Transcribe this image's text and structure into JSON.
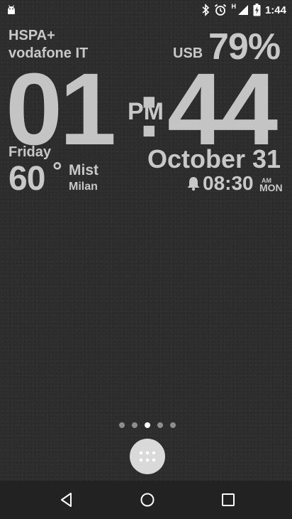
{
  "status_bar": {
    "time": "1:44",
    "network_indicator": "H",
    "icons": [
      "android-icon",
      "bluetooth-icon",
      "alarm-icon",
      "signal-icon",
      "battery-charging-icon"
    ]
  },
  "widget": {
    "network_type": "HSPA+",
    "carrier": "vodafone IT",
    "battery_source": "USB",
    "battery_percent": "79%",
    "hour": "01",
    "separator": ":",
    "ampm": "PM",
    "minute": "44",
    "day": "Friday",
    "date": "October 31",
    "temperature": "60",
    "degree": "°",
    "condition": "Mist",
    "city": "Milan",
    "alarm_time": "08:30",
    "alarm_ampm": "AM",
    "alarm_day": "MON"
  },
  "home": {
    "page_count": 5,
    "active_page": 3
  },
  "colors": {
    "background": "#2e2e2e",
    "widget_text": "#c8c8c8",
    "dot_active": "#ffffff",
    "dot_inactive": "#8e8e8e"
  }
}
